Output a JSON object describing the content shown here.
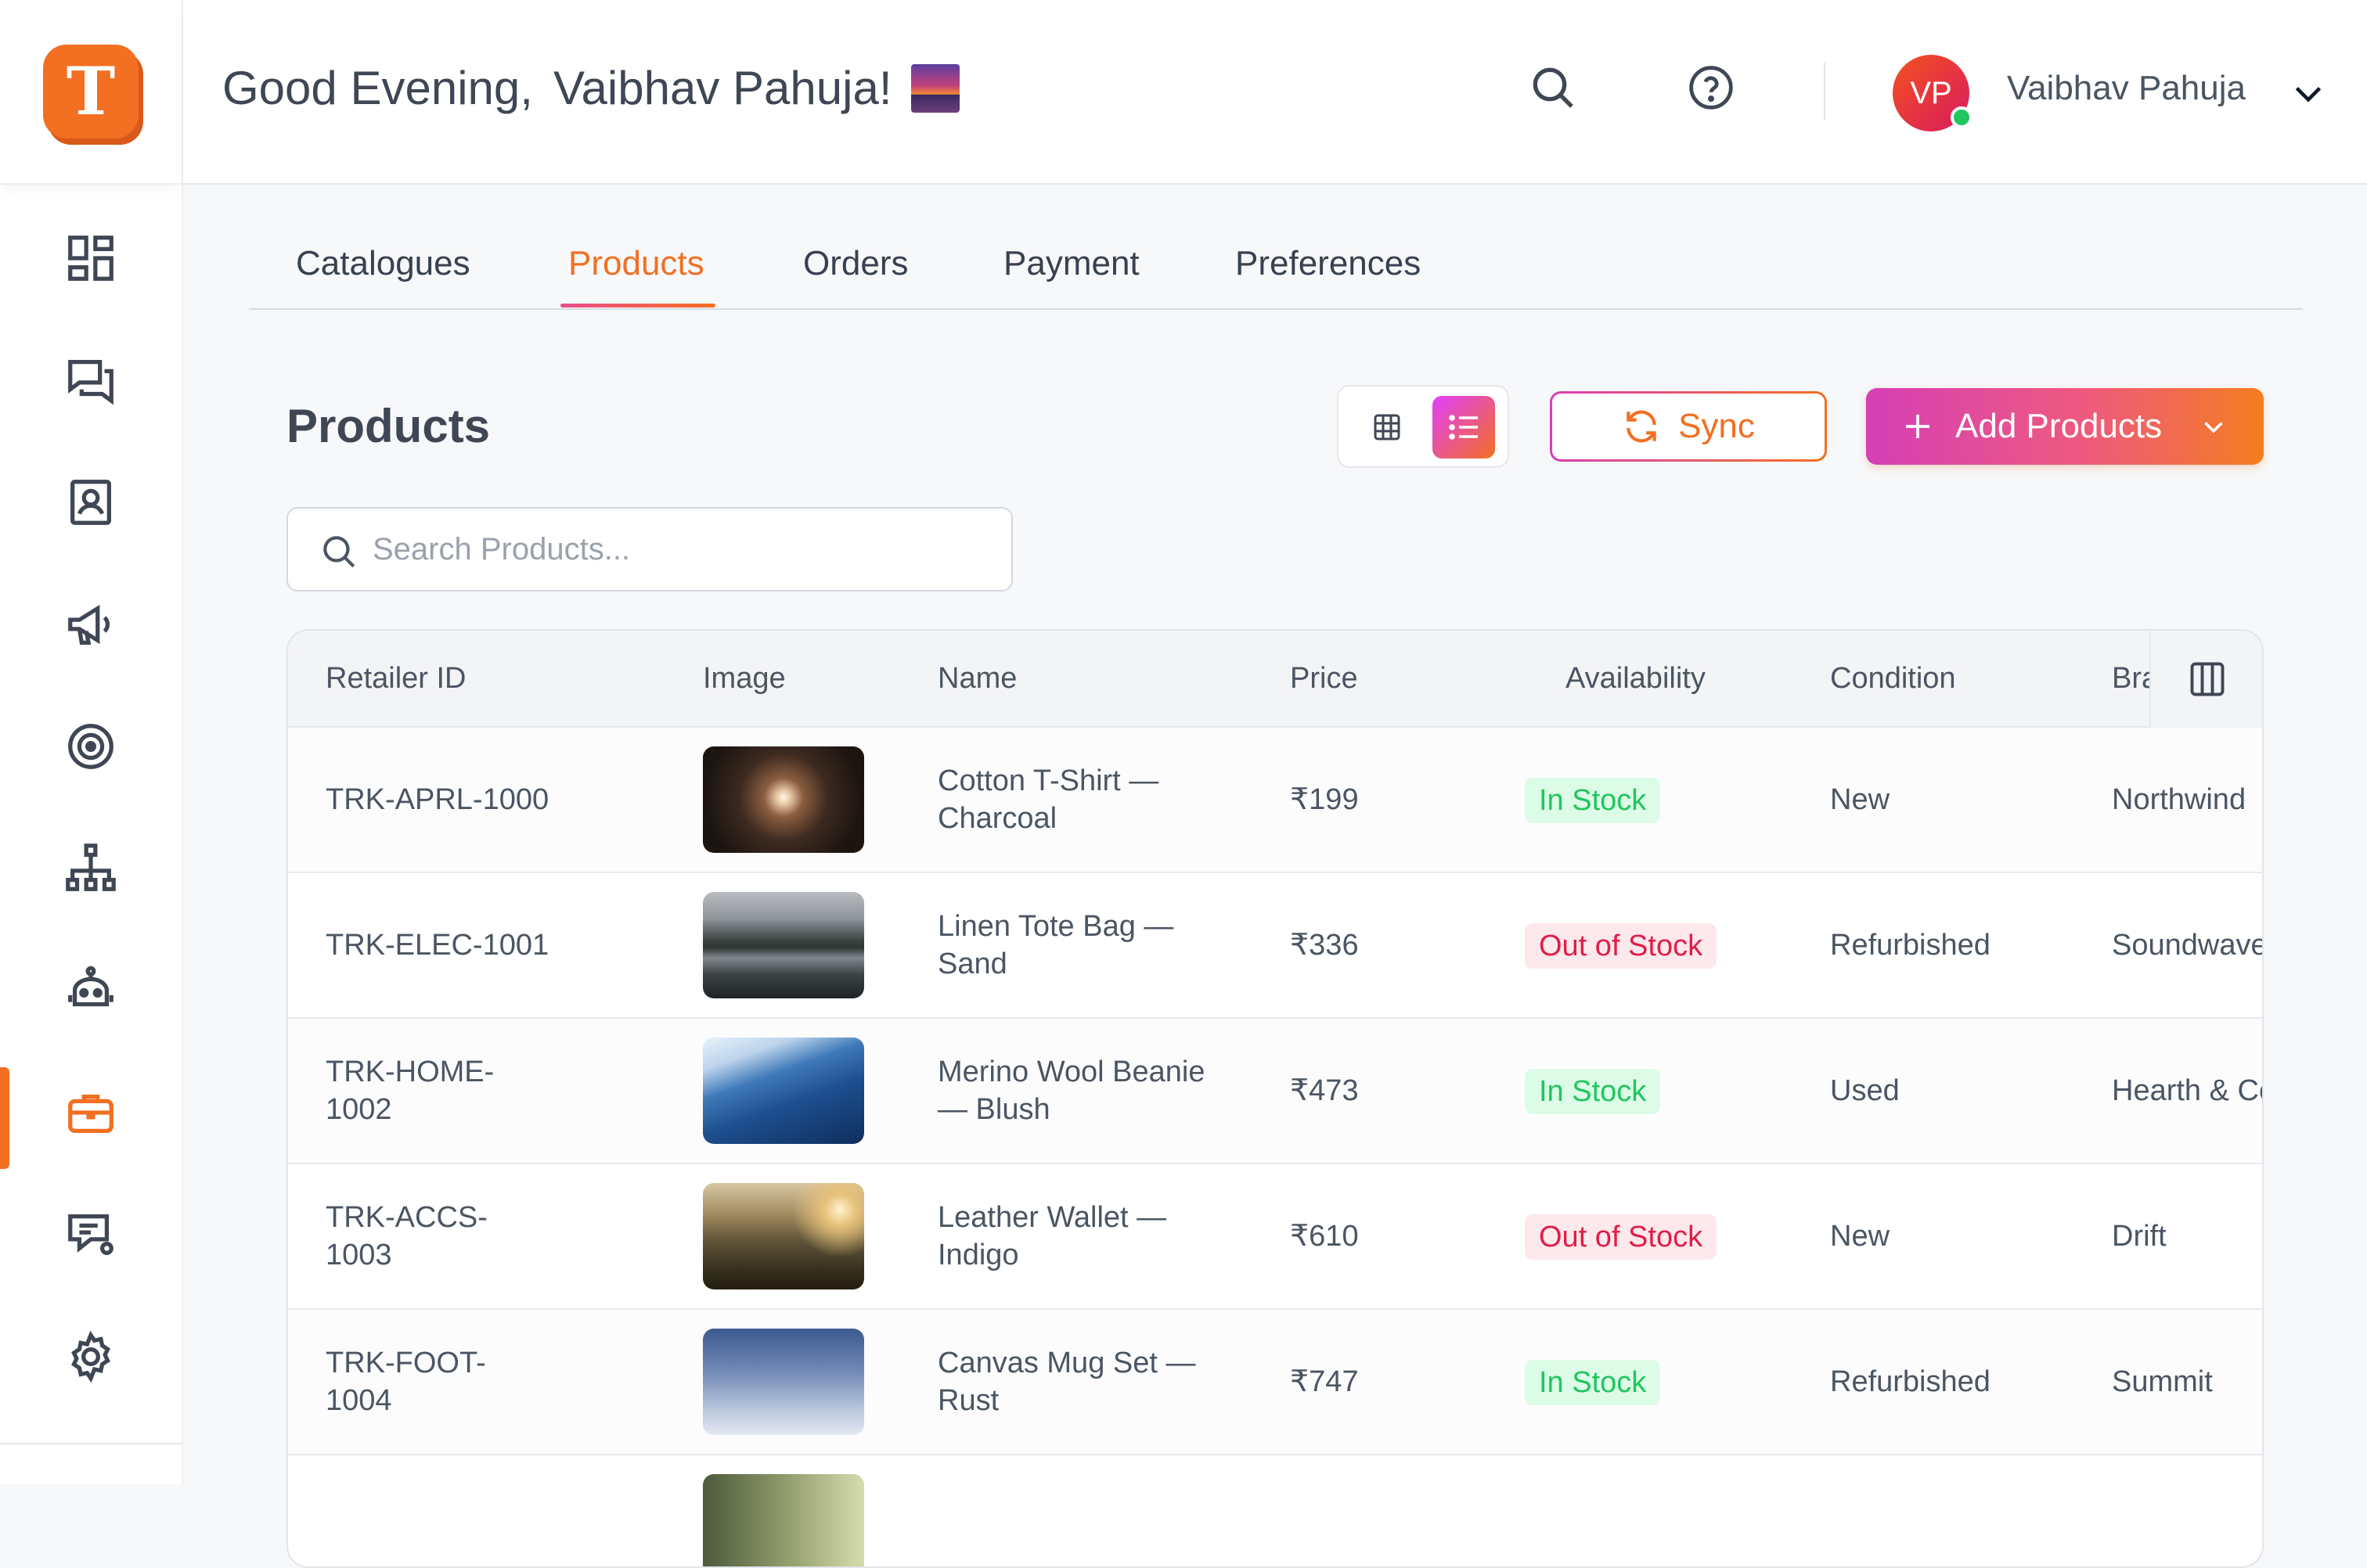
{
  "header": {
    "greeting": "Good Evening,",
    "user_display": "Vaibhav Pahuja!",
    "avatar_initials": "VP",
    "user_name": "Vaibhav Pahuja"
  },
  "logo_letter": "T",
  "sidebar": {
    "items": [
      {
        "icon": "dashboard-icon"
      },
      {
        "icon": "chat-icon"
      },
      {
        "icon": "contact-card-icon"
      },
      {
        "icon": "megaphone-icon"
      },
      {
        "icon": "target-icon"
      },
      {
        "icon": "org-chart-icon"
      },
      {
        "icon": "bot-icon"
      },
      {
        "icon": "briefcase-icon",
        "active": true
      },
      {
        "icon": "chat-settings-icon"
      },
      {
        "icon": "gear-icon"
      }
    ]
  },
  "tabs": [
    {
      "label": "Catalogues"
    },
    {
      "label": "Products",
      "active": true
    },
    {
      "label": "Orders"
    },
    {
      "label": "Payment"
    },
    {
      "label": "Preferences"
    }
  ],
  "page": {
    "title": "Products",
    "sync_label": "Sync",
    "add_label": "Add Products",
    "search_placeholder": "Search Products..."
  },
  "table": {
    "columns": [
      "Retailer ID",
      "Image",
      "Name",
      "Price",
      "Availability",
      "Condition",
      "Bra"
    ],
    "rows": [
      {
        "id": "TRK-APRL-1000",
        "name": "Cotton T-Shirt — Charcoal",
        "price": "₹199",
        "availability": "In Stock",
        "condition": "New",
        "brand": "Northwind"
      },
      {
        "id": "TRK-ELEC-1001",
        "name": "Linen Tote Bag — Sand",
        "price": "₹336",
        "availability": "Out of Stock",
        "condition": "Refurbished",
        "brand": "Soundwave"
      },
      {
        "id": "TRK-HOME-1002",
        "name": "Merino Wool Beanie — Blush",
        "price": "₹473",
        "availability": "In Stock",
        "condition": "Used",
        "brand": "Hearth & Co"
      },
      {
        "id": "TRK-ACCS-1003",
        "name": "Leather Wallet — Indigo",
        "price": "₹610",
        "availability": "Out of Stock",
        "condition": "New",
        "brand": "Drift"
      },
      {
        "id": "TRK-FOOT-1004",
        "name": "Canvas Mug Set — Rust",
        "price": "₹747",
        "availability": "In Stock",
        "condition": "Refurbished",
        "brand": "Summit"
      }
    ]
  },
  "colors": {
    "accent": "#f36f21",
    "gradient_start": "#d63fb6",
    "in_stock": "#22c55e",
    "out_of_stock": "#e11d48"
  }
}
